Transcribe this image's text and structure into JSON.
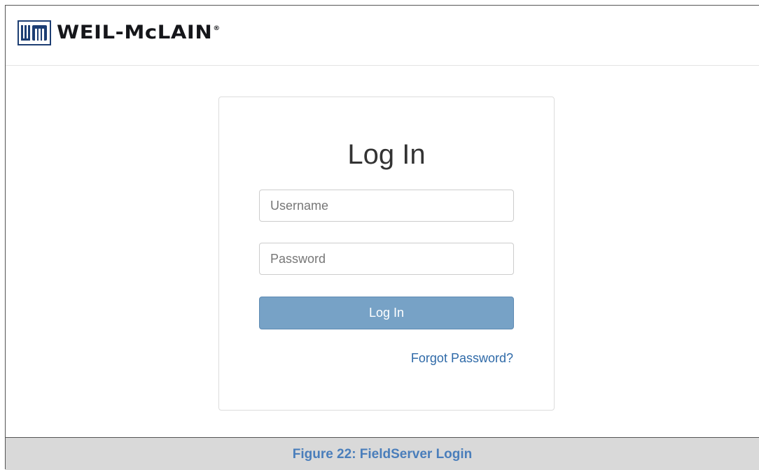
{
  "header": {
    "logo_text": "WEIL-McLAIN",
    "logo_registered": "®",
    "logo_mark_text": "WM"
  },
  "login": {
    "title": "Log In",
    "username_placeholder": "Username",
    "username_value": "",
    "password_placeholder": "Password",
    "password_value": "",
    "submit_label": "Log In",
    "forgot_label": "Forgot Password?"
  },
  "caption": {
    "text": "Figure 22: FieldServer Login"
  },
  "colors": {
    "button_bg": "#77a2c6",
    "link": "#2f6aa8",
    "caption_text": "#4a7ebb",
    "caption_bg": "#d9d9d9",
    "logo_blue": "#1d3e73"
  }
}
